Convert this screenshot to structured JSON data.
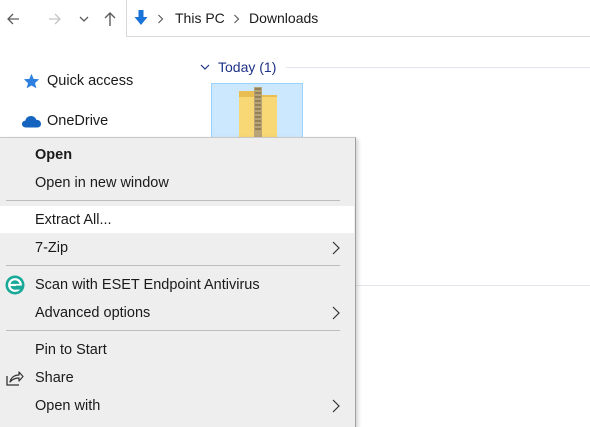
{
  "address": {
    "parts": [
      "This PC",
      "Downloads"
    ]
  },
  "nav_pane": {
    "items": [
      {
        "label": "Quick access",
        "icon": "star-icon"
      },
      {
        "label": "OneDrive",
        "icon": "cloud-icon"
      }
    ]
  },
  "content": {
    "group_label": "Today (1)",
    "file_icon": "zip-folder-icon"
  },
  "context_menu": {
    "items": [
      {
        "label": "Open",
        "bold": true
      },
      {
        "label": "Open in new window"
      },
      {
        "label": "Extract All...",
        "highlighted": true
      },
      {
        "label": "7-Zip",
        "submenu": true
      },
      {
        "label": "Scan with ESET Endpoint Antivirus",
        "icon": "eset-icon"
      },
      {
        "label": "Advanced options",
        "submenu": true
      },
      {
        "label": "Pin to Start"
      },
      {
        "label": "Share",
        "icon": "share-icon"
      },
      {
        "label": "Open with",
        "submenu": true
      }
    ]
  },
  "colors": {
    "accent_blue": "#0078d7",
    "group_header": "#1e3287",
    "selection": "#cce8ff",
    "menu_bg": "#eeeeee"
  }
}
